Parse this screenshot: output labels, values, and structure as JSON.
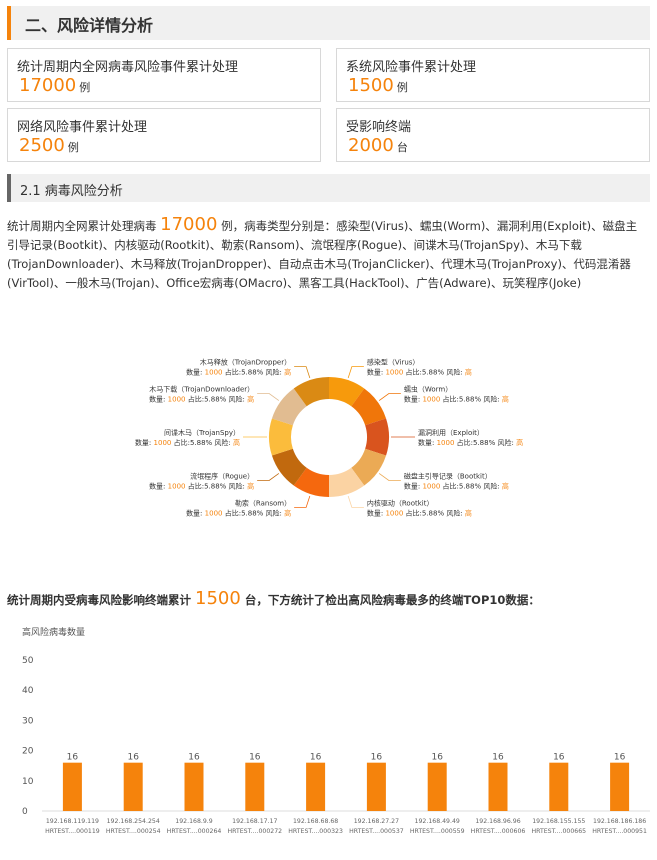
{
  "section_title": "二、风险详情分析",
  "stats": [
    {
      "label": "统计周期内全网病毒风险事件累计处理",
      "value": "17000",
      "unit": "例"
    },
    {
      "label": "系统风险事件累计处理",
      "value": "1500",
      "unit": "例"
    },
    {
      "label": "网络风险事件累计处理",
      "value": "2500",
      "unit": "例"
    },
    {
      "label": "受影响终端",
      "value": "2000",
      "unit": "台"
    }
  ],
  "subsection_title": "2.1 病毒风险分析",
  "paragraph1": {
    "prefix": "统计周期内全网累计处理病毒 ",
    "value": "17000",
    "suffix": " 例，病毒类型分别是：感染型(Virus)、蠕虫(Worm)、漏洞利用(Exploit)、磁盘主引导记录(Bootkit)、内核驱动(Rootkit)、勒索(Ransom)、流氓程序(Rogue)、间谍木马(TrojanSpy)、木马下载(TrojanDownloader)、木马释放(TrojanDropper)、自动点击木马(TrojanClicker)、代理木马(TrojanProxy)、代码混淆器(VirTool)、一般木马(Trojan)、Office宏病毒(OMacro)、黑客工具(HackTool)、广告(Adware)、玩笑程序(Joke)"
  },
  "paragraph2": {
    "prefix": "统计周期内受病毒风险影响终端累计 ",
    "value": "1500",
    "suffix": " 台，下方统计了检出高风险病毒最多的终端TOP10数据："
  },
  "chart_data": [
    {
      "type": "pie",
      "slices": [
        {
          "name": "感染型（Virus）",
          "value": 1000,
          "ratio": "5.88%",
          "risk": "高",
          "color": "#f79a0c"
        },
        {
          "name": "蠕虫（Worm）",
          "value": 1000,
          "ratio": "5.88%",
          "risk": "高",
          "color": "#f0760a"
        },
        {
          "name": "漏洞利用（Exploit）",
          "value": 1000,
          "ratio": "5.88%",
          "risk": "高",
          "color": "#d9541e"
        },
        {
          "name": "磁盘主引导记录（Bootkit）",
          "value": 1000,
          "ratio": "5.88%",
          "risk": "高",
          "color": "#ebaa55"
        },
        {
          "name": "内核驱动（Rootkit）",
          "value": 1000,
          "ratio": "5.88%",
          "risk": "高",
          "color": "#fbd3a3"
        },
        {
          "name": "勒索（Ransom）",
          "value": 1000,
          "ratio": "5.88%",
          "risk": "高",
          "color": "#f5680e"
        },
        {
          "name": "流氓程序（Rogue）",
          "value": 1000,
          "ratio": "5.88%",
          "risk": "高",
          "color": "#c1690e"
        },
        {
          "name": "间谍木马（TrojanSpy）",
          "value": 1000,
          "ratio": "5.88%",
          "risk": "高",
          "color": "#fbbc3c"
        },
        {
          "name": "木马下载（TrojanDownloader）",
          "value": 1000,
          "ratio": "5.88%",
          "risk": "高",
          "color": "#e1bc91"
        },
        {
          "name": "木马释放（TrojanDropper）",
          "value": 1000,
          "ratio": "5.88%",
          "risk": "高",
          "color": "#da8a14"
        }
      ],
      "label_words": {
        "count": "数量:",
        "ratio": "占比:",
        "risk": "风险:"
      }
    },
    {
      "type": "bar",
      "ylabel": "高风险病毒数量",
      "ylim": [
        0,
        50
      ],
      "yticks": [
        0,
        10,
        20,
        30,
        40,
        50
      ],
      "color": "#f5830c",
      "categories": [
        {
          "ip": "192.168.119.119",
          "host": "HRTEST....000119"
        },
        {
          "ip": "192.168.254.254",
          "host": "HRTEST....000254"
        },
        {
          "ip": "192.168.9.9",
          "host": "HRTEST....000264"
        },
        {
          "ip": "192.168.17.17",
          "host": "HRTEST....000272"
        },
        {
          "ip": "192.168.68.68",
          "host": "HRTEST....000323"
        },
        {
          "ip": "192.168.27.27",
          "host": "HRTEST....000537"
        },
        {
          "ip": "192.168.49.49",
          "host": "HRTEST....000559"
        },
        {
          "ip": "192.168.96.96",
          "host": "HRTEST....000606"
        },
        {
          "ip": "192.168.155.155",
          "host": "HRTEST....000665"
        },
        {
          "ip": "192.168.186.186",
          "host": "HRTEST....000951"
        }
      ],
      "values": [
        16,
        16,
        16,
        16,
        16,
        16,
        16,
        16,
        16,
        16
      ]
    }
  ]
}
